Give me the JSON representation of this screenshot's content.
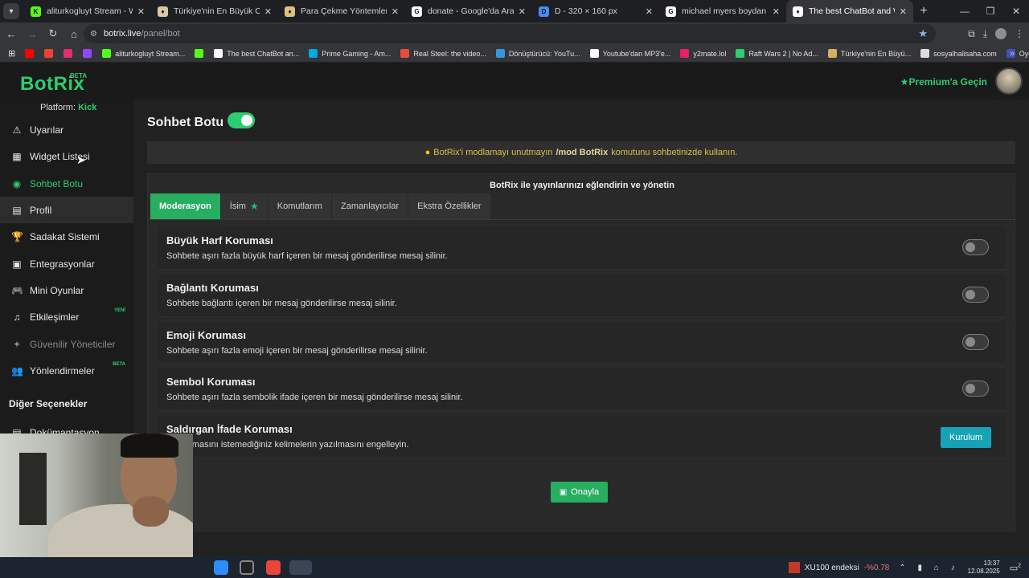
{
  "tabs": [
    {
      "title": "aliturkogluyt Stream - Watch Li",
      "fav_color": "#53fc18",
      "fav_glyph": "K"
    },
    {
      "title": "Türkiye'nin En Büyük Oyuncu D",
      "fav_color": "#d7c9a8",
      "fav_glyph": "♦"
    },
    {
      "title": "Para Çekme Yöntemlerim",
      "fav_color": "#e0c080",
      "fav_glyph": "♦"
    },
    {
      "title": "donate - Google'da Ara",
      "fav_color": "#ffffff",
      "fav_glyph": "G"
    },
    {
      "title": "D - 320 × 160 px",
      "fav_color": "#4b8bf5",
      "fav_glyph": "D"
    },
    {
      "title": "michael myers boydan - Googl",
      "fav_color": "#ffffff",
      "fav_glyph": "G"
    },
    {
      "title": "The best ChatBot and Widgets",
      "fav_color": "#ffffff",
      "fav_glyph": "♦"
    }
  ],
  "address": {
    "host": "botrix.live",
    "path": "/panel/bot"
  },
  "bookmarks": [
    {
      "label": "",
      "color": "#ff0000"
    },
    {
      "label": "",
      "color": "#ea4335"
    },
    {
      "label": "",
      "color": "#e1306c"
    },
    {
      "label": "",
      "color": "#9146ff"
    },
    {
      "label": "aliturkogluyt Stream...",
      "color": "#53fc18"
    },
    {
      "label": "",
      "color": "#53fc18"
    },
    {
      "label": "The best ChatBot an...",
      "color": "#ffffff"
    },
    {
      "label": "Prime Gaming - Am...",
      "color": "#00a8e1"
    },
    {
      "label": "Real Steel: the video...",
      "color": "#e74c3c"
    },
    {
      "label": "Dönüştürücü: YouTu...",
      "color": "#3498db"
    },
    {
      "label": "Youtube'dan MP3'e...",
      "color": "#ffffff"
    },
    {
      "label": "y2mate.lol",
      "color": "#e91e63"
    },
    {
      "label": "Raft Wars 2 | No Ad...",
      "color": "#2ecc71"
    },
    {
      "label": "Türkiye'nin En Büyü...",
      "color": "#d4b060"
    },
    {
      "label": "sosyalhalisaha.com",
      "color": "#dddddd"
    },
    {
      "label": "Oyuncular | Aternos...",
      "color": "#3f51b5"
    }
  ],
  "app": {
    "logo": "BotRix",
    "logo_beta": "BETA",
    "premium": "Premium'a Geçin",
    "platform_label": "Platform:",
    "platform_value": "Kick"
  },
  "sidebar": {
    "items": [
      {
        "label": "Uyarılar",
        "icon": "⚠",
        "name": "alerts"
      },
      {
        "label": "Widget Listesi",
        "icon": "▦",
        "name": "widget-list"
      },
      {
        "label": "Sohbet Botu",
        "icon": "◉",
        "name": "chat-bot"
      },
      {
        "label": "Profil",
        "icon": "▤",
        "name": "profile"
      },
      {
        "label": "Sadakat Sistemi",
        "icon": "🏆",
        "name": "loyalty"
      },
      {
        "label": "Entegrasyonlar",
        "icon": "▣",
        "name": "integrations"
      },
      {
        "label": "Mini Oyunlar",
        "icon": "🎮",
        "name": "mini-games"
      },
      {
        "label": "Etkileşimler",
        "icon": "♫",
        "name": "interactions",
        "badge": "YENİ"
      },
      {
        "label": "Güvenilir Yöneticiler",
        "icon": "✦",
        "name": "trusted-managers"
      },
      {
        "label": "Yönlendirmeler",
        "icon": "👥",
        "name": "redirects",
        "badge": "BETA"
      }
    ],
    "section": "Diğer Seçenekler",
    "docs": "Dokümantasyon"
  },
  "main": {
    "title": "Sohbet Botu",
    "alert_prefix": "BotRix'i modlamayı unutmayın",
    "alert_cmd": "/mod BotRix",
    "alert_suffix": "komutunu sohbetinizde kullanın.",
    "panel_title": "BotRix ile yayınlarınızı eğlendirin ve yönetin",
    "tabs": [
      "Moderasyon",
      "İsim",
      "Komutlarım",
      "Zamanlayıcılar",
      "Ekstra Özellikler"
    ],
    "rows": [
      {
        "title": "Büyük Harf Koruması",
        "desc": "Sohbete aşırı fazla büyük harf içeren bir mesaj gönderilirse mesaj silinir."
      },
      {
        "title": "Bağlantı Koruması",
        "desc": "Sohbete bağlantı içeren bir mesaj gönderilirse mesaj silinir."
      },
      {
        "title": "Emoji Koruması",
        "desc": "Sohbete aşırı fazla emoji içeren bir mesaj gönderilirse mesaj silinir."
      },
      {
        "title": "Sembol Koruması",
        "desc": "Sohbete aşırı fazla sembolik ifade içeren bir mesaj gönderilirse mesaj silinir."
      },
      {
        "title": "Saldırgan İfade Koruması",
        "desc": "e yazılmasını istemediğiniz kelimelerin yazılmasını engelleyin."
      }
    ],
    "setup_button": "Kurulum",
    "approve_button": "Onayla"
  },
  "taskbar": {
    "stock_name": "XU100 endeksi",
    "stock_change": "-%0.78",
    "time": "13:37",
    "date": "12.08.2025",
    "notif_count": "2"
  }
}
